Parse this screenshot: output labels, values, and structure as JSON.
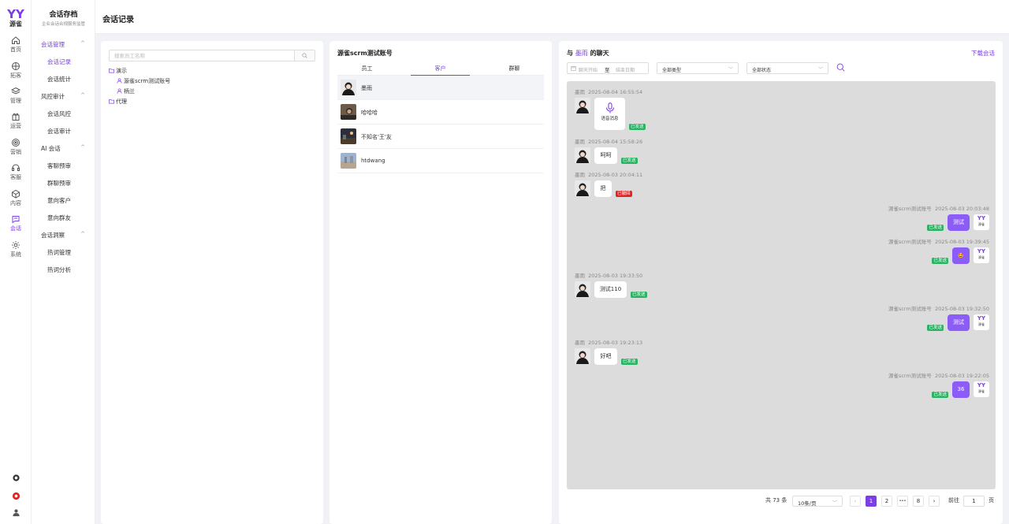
{
  "brand": {
    "mark": "YY",
    "name": "源雀"
  },
  "rail": [
    {
      "label": "首页",
      "icon": "home-icon"
    },
    {
      "label": "拓客",
      "icon": "compass-icon"
    },
    {
      "label": "管理",
      "icon": "layers-icon"
    },
    {
      "label": "运营",
      "icon": "gift-icon"
    },
    {
      "label": "营销",
      "icon": "target-icon"
    },
    {
      "label": "客服",
      "icon": "headset-icon"
    },
    {
      "label": "内容",
      "icon": "cube-icon"
    },
    {
      "label": "会话",
      "icon": "chat-icon",
      "active": true
    },
    {
      "label": "系统",
      "icon": "gear-icon"
    }
  ],
  "submenu": {
    "title": "会话存档",
    "desc": "企业会话合规服务监管",
    "groups": [
      {
        "label": "会话管理",
        "items": [
          "会话记录",
          "会话统计"
        ]
      },
      {
        "label": "风控审计",
        "items": [
          "会话风控",
          "会话审计"
        ]
      },
      {
        "label": "AI 会话",
        "items": [
          "客聊预审",
          "群聊预审",
          "意向客户",
          "意向群友"
        ]
      },
      {
        "label": "会话洞察",
        "items": [
          "热词管理",
          "热词分析"
        ]
      }
    ]
  },
  "header": {
    "title": "会话记录"
  },
  "staff": {
    "search_placeholder": "搜索员工名称",
    "tree": [
      {
        "label": "演示",
        "type": "folder"
      },
      {
        "label": "源雀scrm测试账号",
        "type": "user"
      },
      {
        "label": "柄兰",
        "type": "user"
      },
      {
        "label": "代理",
        "type": "folder"
      }
    ]
  },
  "contacts": {
    "account": "源雀scrm测试账号",
    "tabs": [
      "员工",
      "客户",
      "群聊"
    ],
    "active_tab": 1,
    "list": [
      {
        "name": "墨雨"
      },
      {
        "name": "哈哈哈"
      },
      {
        "name": "不知名'王'友"
      },
      {
        "name": "htdwang"
      }
    ]
  },
  "chat": {
    "prefix": "与",
    "partner": "墨雨",
    "suffix": "的聊天",
    "download": "下载会话",
    "date_start_placeholder": "聊天开始",
    "date_to": "至",
    "date_end_placeholder": "结束日期",
    "type_filter": "全部类型",
    "status_filter": "全部状态",
    "voice_label": "语音消息",
    "mini_logo": "YY",
    "mini_text": "源雀",
    "messages": [
      {
        "dir": "in",
        "sender": "墨雨",
        "time": "2025-08-04 16:55:54",
        "kind": "voice",
        "status": "已发送",
        "status_type": "ok"
      },
      {
        "dir": "in",
        "sender": "墨雨",
        "time": "2025-08-04 15:58:26",
        "text": "呵呵",
        "status": "已发送",
        "status_type": "ok"
      },
      {
        "dir": "in",
        "sender": "墨雨",
        "time": "2025-08-03 20:04:11",
        "text": "把",
        "status": "已撤回",
        "status_type": "bad"
      },
      {
        "dir": "out",
        "sender": "源雀scrm测试账号",
        "time": "2025-08-03 20:03:48",
        "text": "测试",
        "status": "已发送",
        "status_type": "ok"
      },
      {
        "dir": "out",
        "sender": "源雀scrm测试账号",
        "time": "2025-08-03 19:39:45",
        "text": "🤩",
        "status": "已发送",
        "status_type": "ok"
      },
      {
        "dir": "in",
        "sender": "墨雨",
        "time": "2025-08-03 19:33:50",
        "text": "测试110",
        "status": "已发送",
        "status_type": "ok"
      },
      {
        "dir": "out",
        "sender": "源雀scrm测试账号",
        "time": "2025-08-03 19:32:50",
        "text": "测试",
        "status": "已发送",
        "status_type": "ok"
      },
      {
        "dir": "in",
        "sender": "墨雨",
        "time": "2025-08-03 19:23:13",
        "text": "好吧",
        "status": "已发送",
        "status_type": "ok"
      },
      {
        "dir": "out",
        "sender": "源雀scrm测试账号",
        "time": "2025-08-03 19:22:05",
        "text": "36",
        "status": "已发送",
        "status_type": "ok"
      }
    ]
  },
  "pagination": {
    "total": "共 73 条",
    "page_size": "10条/页",
    "pages": [
      "1",
      "2",
      "•••",
      "8"
    ],
    "active": 0,
    "goto_label": "前往",
    "goto_value": "1",
    "page_suffix": "页"
  },
  "colors": {
    "accent": "#7b3fe4",
    "bubble_out": "#8b5cf6",
    "sent": "#28b463",
    "recalled": "#e02424"
  }
}
